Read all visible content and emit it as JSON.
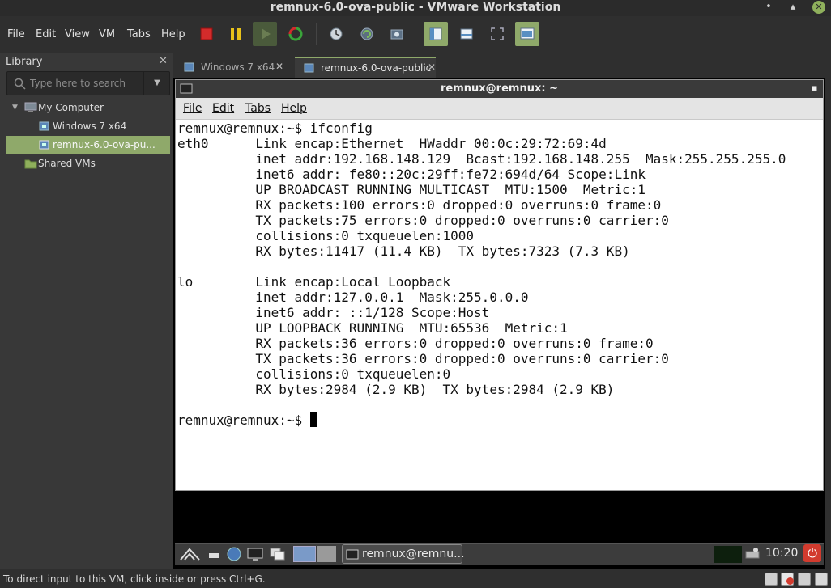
{
  "window": {
    "title": "remnux-6.0-ova-public - VMware Workstation",
    "minimize_glyph": "•",
    "maximize_glyph": "▴",
    "close_glyph": "✕"
  },
  "menu": [
    "File",
    "Edit",
    "View",
    "VM",
    "Tabs",
    "Help"
  ],
  "library": {
    "header": "Library",
    "close_glyph": "✕",
    "search_placeholder": "Type here to search",
    "tree": {
      "root": "My Computer",
      "vms": [
        "Windows 7 x64",
        "remnux-6.0-ova-pu..."
      ],
      "shared": "Shared VMs"
    }
  },
  "tabs": [
    {
      "label": "Windows 7 x64",
      "active": false
    },
    {
      "label": "remnux-6.0-ova-public",
      "active": true
    }
  ],
  "terminal": {
    "title": "remnux@remnux: ~",
    "menu": [
      "File",
      "Edit",
      "Tabs",
      "Help"
    ],
    "prompt": "remnux@remnux:~$",
    "command": "ifconfig",
    "output": [
      "eth0      Link encap:Ethernet  HWaddr 00:0c:29:72:69:4d",
      "          inet addr:192.168.148.129  Bcast:192.168.148.255  Mask:255.255.255.0",
      "          inet6 addr: fe80::20c:29ff:fe72:694d/64 Scope:Link",
      "          UP BROADCAST RUNNING MULTICAST  MTU:1500  Metric:1",
      "          RX packets:100 errors:0 dropped:0 overruns:0 frame:0",
      "          TX packets:75 errors:0 dropped:0 overruns:0 carrier:0",
      "          collisions:0 txqueuelen:1000",
      "          RX bytes:11417 (11.4 KB)  TX bytes:7323 (7.3 KB)",
      "",
      "lo        Link encap:Local Loopback",
      "          inet addr:127.0.0.1  Mask:255.0.0.0",
      "          inet6 addr: ::1/128 Scope:Host",
      "          UP LOOPBACK RUNNING  MTU:65536  Metric:1",
      "          RX packets:36 errors:0 dropped:0 overruns:0 frame:0",
      "          TX packets:36 errors:0 dropped:0 overruns:0 carrier:0",
      "          collisions:0 txqueuelen:0",
      "          RX bytes:2984 (2.9 KB)  TX bytes:2984 (2.9 KB)",
      ""
    ],
    "title_buttons": [
      "_",
      "▪"
    ]
  },
  "guest_panel": {
    "task_label": "remnux@remnu...",
    "clock": "10:20"
  },
  "statusbar": {
    "message": "To direct input to this VM, click inside or press Ctrl+G."
  }
}
